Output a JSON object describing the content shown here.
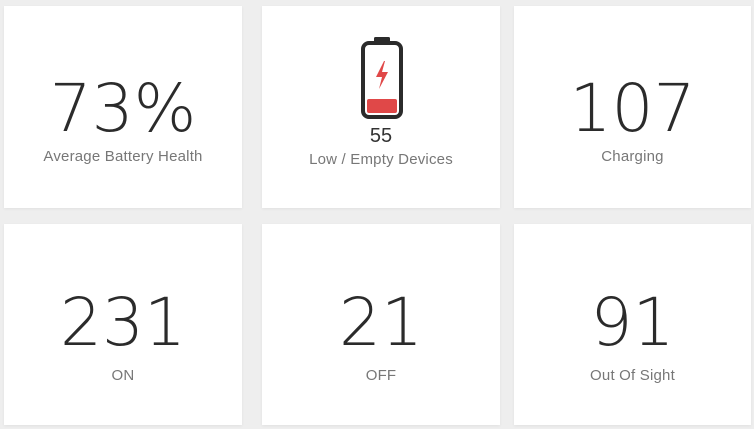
{
  "tiles": {
    "battery_health": {
      "value": "73%",
      "label": "Average Battery Health"
    },
    "low_empty": {
      "value": "55",
      "label": "Low / Empty Devices",
      "icon": "battery-low-icon",
      "accent_color": "#e04848"
    },
    "charging": {
      "value": "107",
      "label": "Charging"
    },
    "on": {
      "value": "231",
      "label": "ON"
    },
    "off": {
      "value": "21",
      "label": "OFF"
    },
    "out_of_sight": {
      "value": "91",
      "label": "Out Of Sight"
    }
  },
  "colors": {
    "background": "#eeeeee",
    "tile": "#ffffff",
    "value_text": "#2b2b2b",
    "label_text": "#777777",
    "accent": "#e04848"
  }
}
